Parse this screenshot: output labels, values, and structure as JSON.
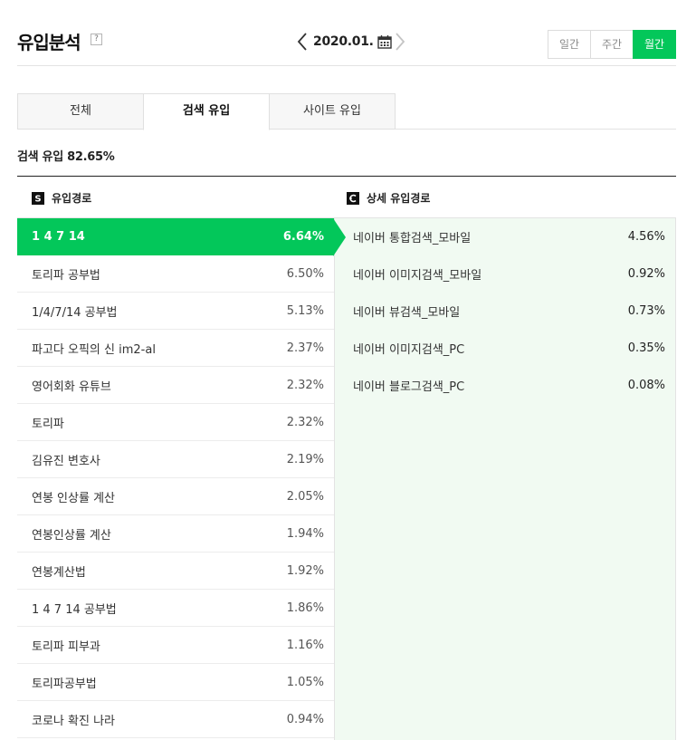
{
  "header": {
    "title": "유입분석",
    "help": "?",
    "date": "2020.01.",
    "period": [
      {
        "label": "일간",
        "active": false
      },
      {
        "label": "주간",
        "active": false
      },
      {
        "label": "월간",
        "active": true
      }
    ]
  },
  "tabs": [
    {
      "label": "전체",
      "active": false
    },
    {
      "label": "검색 유입",
      "active": true
    },
    {
      "label": "사이트 유입",
      "active": false
    }
  ],
  "summary": "검색 유입 82.65%",
  "columns": {
    "left": {
      "icon_letter": "S",
      "label": "유입경로"
    },
    "right": {
      "label": "상세 유입경로"
    }
  },
  "keywords": [
    {
      "label": "1 4 7 14",
      "pct": "6.64%"
    },
    {
      "label": "토리파 공부법",
      "pct": "6.50%"
    },
    {
      "label": "1/4/7/14 공부법",
      "pct": "5.13%"
    },
    {
      "label": "파고다 오픽의 신 im2-al",
      "pct": "2.37%"
    },
    {
      "label": "영어회화 유튜브",
      "pct": "2.32%"
    },
    {
      "label": "토리파",
      "pct": "2.32%"
    },
    {
      "label": "김유진 변호사",
      "pct": "2.19%"
    },
    {
      "label": "연봉 인상률 계산",
      "pct": "2.05%"
    },
    {
      "label": "연봉인상률 계산",
      "pct": "1.94%"
    },
    {
      "label": "연봉계산법",
      "pct": "1.92%"
    },
    {
      "label": "1 4 7 14 공부법",
      "pct": "1.86%"
    },
    {
      "label": "토리파 피부과",
      "pct": "1.16%"
    },
    {
      "label": "토리파공부법",
      "pct": "1.05%"
    },
    {
      "label": "코로나 확진 나라",
      "pct": "0.94%"
    }
  ],
  "details": [
    {
      "label": "네이버 통합검색_모바일",
      "pct": "4.56%"
    },
    {
      "label": "네이버 이미지검색_모바일",
      "pct": "0.92%"
    },
    {
      "label": "네이버 뷰검색_모바일",
      "pct": "0.73%"
    },
    {
      "label": "네이버 이미지검색_PC",
      "pct": "0.35%"
    },
    {
      "label": "네이버 블로그검색_PC",
      "pct": "0.08%"
    }
  ],
  "colors": {
    "accent": "#03c75a",
    "panel": "#f1faf2"
  }
}
